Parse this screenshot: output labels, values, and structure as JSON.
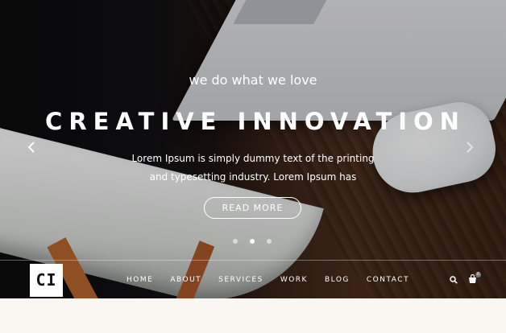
{
  "hero": {
    "tagline": "we do what we love",
    "headline": "CREATIVE  INNOVATION",
    "description": "Lorem Ipsum is simply dummy text of the printing and typesetting industry. Lorem Ipsum has",
    "cta_label": "READ MORE",
    "slides_count": 3,
    "active_slide": 2
  },
  "navbar": {
    "logo_text": "CI",
    "items": [
      {
        "label": "HOME"
      },
      {
        "label": "ABOUT"
      },
      {
        "label": "SERVICES"
      },
      {
        "label": "WORK"
      },
      {
        "label": "BLOG"
      },
      {
        "label": "CONTACT"
      }
    ],
    "cart_count": "0",
    "icons": [
      "search-icon",
      "cart-icon"
    ]
  },
  "colors": {
    "text": "#ffffff",
    "hero_dark": "#111114",
    "wood": "#4a2d1c",
    "page_bg": "#faf7f2"
  }
}
